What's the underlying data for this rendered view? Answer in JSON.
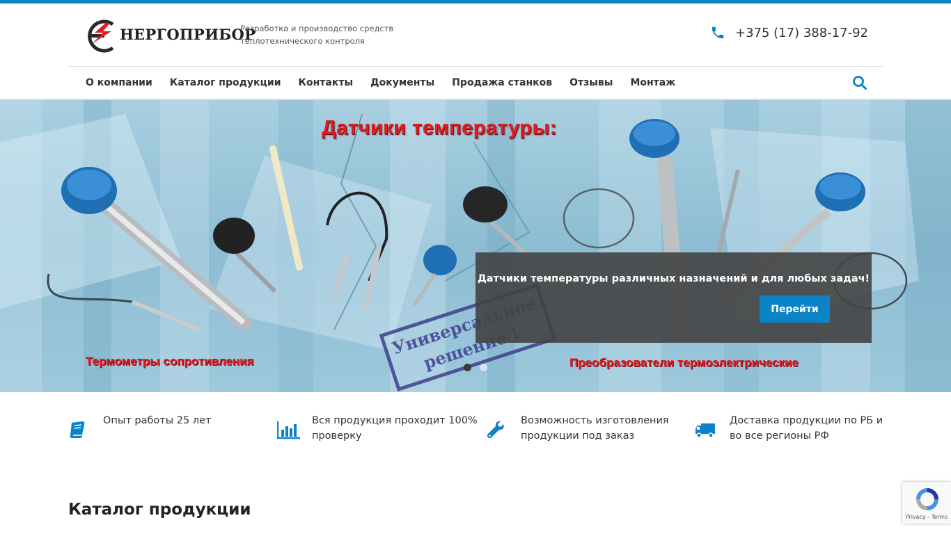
{
  "brand": {
    "name": "НЕРГОПРИБОР",
    "tagline_line1": "Разработка и производство средств",
    "tagline_line2": "теплотехнического контроля",
    "phone": "+375 (17) 388-17-92",
    "accent_color": "#0b83c7"
  },
  "nav": {
    "items": [
      {
        "label": "О компании"
      },
      {
        "label": "Каталог продукции"
      },
      {
        "label": "Контакты"
      },
      {
        "label": "Документы"
      },
      {
        "label": "Продажа станков"
      },
      {
        "label": "Отзывы"
      },
      {
        "label": "Монтаж"
      }
    ],
    "search_icon": "search-icon"
  },
  "hero": {
    "heading": "Датчики температуры:",
    "label_left": "Термометры сопротивления",
    "label_right": "Преобразователи термоэлектрические",
    "stamp_line1": "Универсальное",
    "stamp_line2": "решение !",
    "caption": "Датчики температуры различных назначений и для любых задач!",
    "button_label": "Перейти",
    "slides": 2,
    "active_slide": 1
  },
  "features": [
    {
      "icon": "book-icon",
      "text": "Опыт работы 25 лет"
    },
    {
      "icon": "bar-chart-icon",
      "text": "Вся продукция проходит 100% проверку"
    },
    {
      "icon": "wrench-icon",
      "text": "Возможность изготовления продукции под заказ"
    },
    {
      "icon": "truck-icon",
      "text": "Доставка продукции по РБ и во все регионы РФ"
    }
  ],
  "catalog": {
    "title": "Каталог продукции"
  },
  "recaptcha": {
    "links": "Privacy - Terms"
  }
}
